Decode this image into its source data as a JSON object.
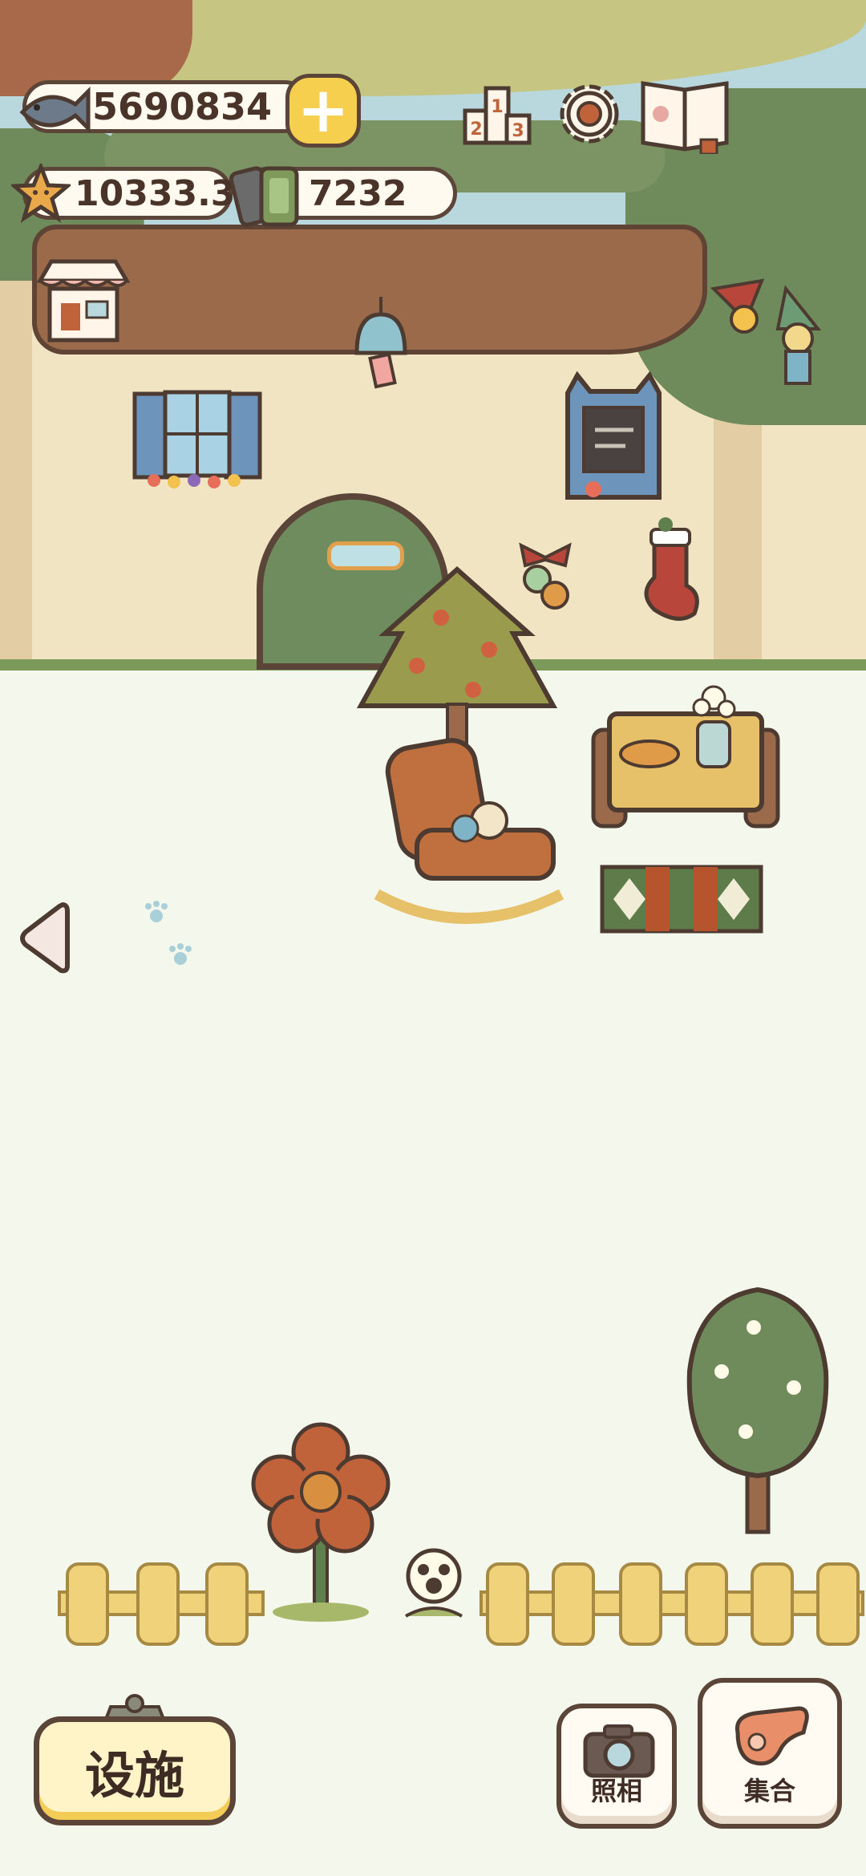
{
  "hud": {
    "fish_count": "5690834",
    "star_count": "10333.3",
    "ticket_count": "7232",
    "add_button_symbol": "+",
    "icons": [
      "fish-icon",
      "star-icon",
      "ticket-icon",
      "ranking-icon",
      "gear-icon",
      "book-icon",
      "shop-icon"
    ]
  },
  "bottom_bar": {
    "facility_label": "设施",
    "photo_label": "照相",
    "gather_label": "集合"
  },
  "colors": {
    "outline": "#5b4438",
    "accent_yellow": "#f6cf4e",
    "foliage": "#6f8a5b",
    "wall": "#f1e4c3",
    "ground": "#f4f8ec"
  }
}
